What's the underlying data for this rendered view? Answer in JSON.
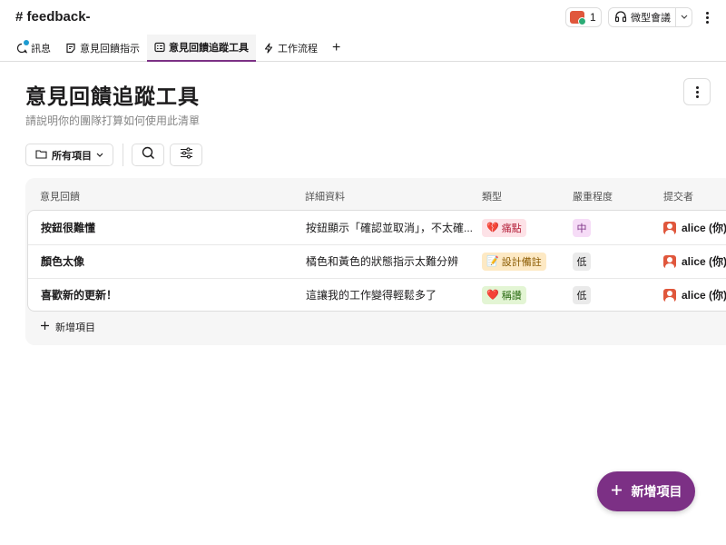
{
  "header": {
    "channel_title": "# feedback-",
    "huddle_count": "1",
    "huddle_label": "微型會議"
  },
  "tabs": [
    {
      "label": "訊息",
      "icon": "message-icon"
    },
    {
      "label": "意見回饋指示",
      "icon": "canvas-icon"
    },
    {
      "label": "意見回饋追蹤工具",
      "icon": "list-icon",
      "active": true
    },
    {
      "label": "工作流程",
      "icon": "workflow-icon"
    }
  ],
  "page": {
    "title": "意見回饋追蹤工具",
    "subtitle": "請說明你的團隊打算如何使用此清單"
  },
  "toolbar": {
    "filter_label": "所有項目"
  },
  "table": {
    "columns": [
      "意見回饋",
      "詳細資料",
      "類型",
      "嚴重程度",
      "提交者"
    ],
    "rows": [
      {
        "title": "按鈕很難懂",
        "detail": "按鈕顯示「確認並取消」，不太確...",
        "type": "痛點",
        "type_icon": "💔",
        "severity": "中",
        "submitter": "alice (你)"
      },
      {
        "title": "顏色太像",
        "detail": "橘色和黃色的狀態指示太難分辨",
        "type": "設計備註",
        "type_icon": "📝",
        "severity": "低",
        "submitter": "alice (你)"
      },
      {
        "title": "喜歡新的更新！",
        "detail": "這讓我的工作變得輕鬆多了",
        "type": "稱讚",
        "type_icon": "❤️",
        "severity": "低",
        "submitter": "alice (你)"
      }
    ],
    "add_item_label": "新增項目"
  },
  "fab": {
    "label": "新增項目"
  },
  "colors": {
    "accent": "#7c3085",
    "tag_pain": "#fde2e7",
    "tag_design": "#fde9c4",
    "tag_praise": "#e3f5d4",
    "sev_medium": "#f6dcf7",
    "sev_low": "#eaeaea"
  }
}
